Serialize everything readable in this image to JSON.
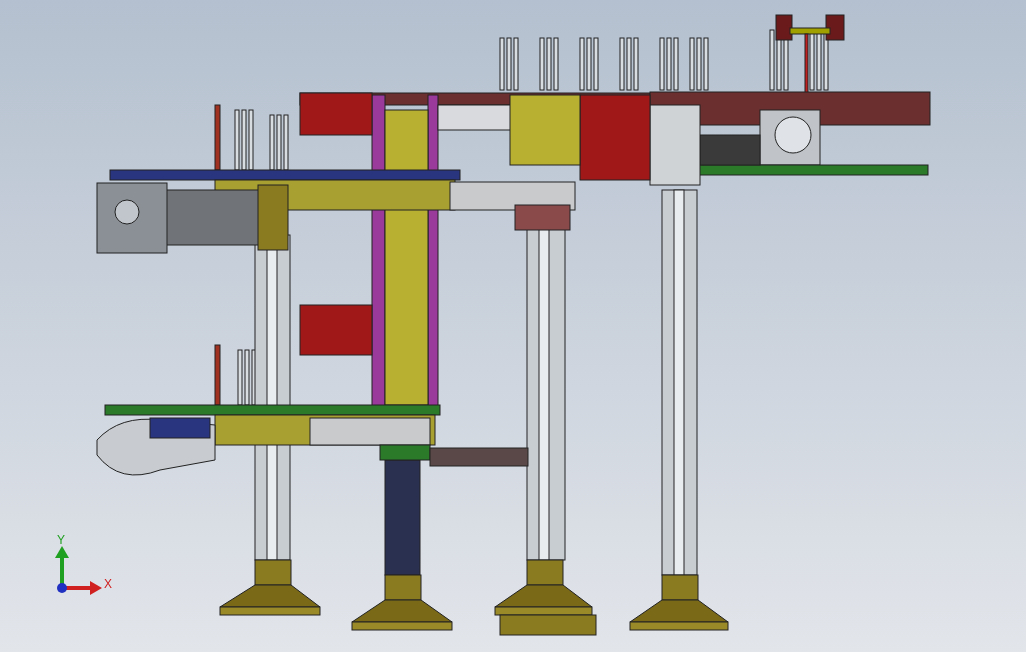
{
  "viewport": {
    "triad": {
      "axes": [
        {
          "label": "Y",
          "color": "#20a020"
        },
        {
          "label": "X",
          "color": "#d02020"
        }
      ]
    }
  }
}
